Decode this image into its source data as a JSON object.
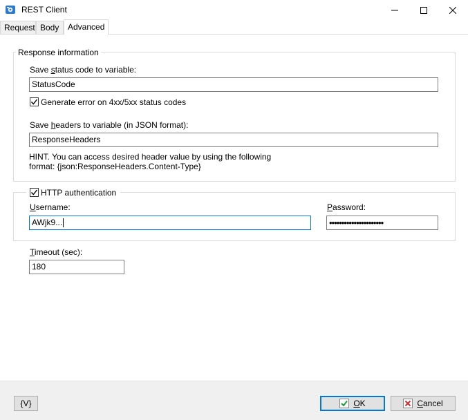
{
  "window": {
    "title": "REST Client",
    "icon": "rest-client-app-icon",
    "controls": {
      "minimize": "minimize-icon",
      "maximize": "maximize-icon",
      "close": "close-icon"
    }
  },
  "tabs": [
    {
      "label": "Request",
      "active": false
    },
    {
      "label": "Body",
      "active": false
    },
    {
      "label": "Advanced",
      "active": true
    }
  ],
  "response_info": {
    "legend": "Response information",
    "status_label_pre": "Save ",
    "status_label_accel": "s",
    "status_label_post": "tatus code to variable:",
    "status_value": "StatusCode",
    "generate_error_label": "Generate error on 4xx/5xx  status codes",
    "generate_error_checked": true,
    "headers_label_pre": "Save ",
    "headers_label_accel": "h",
    "headers_label_post": "eaders to variable (in JSON format):",
    "headers_value": "ResponseHeaders",
    "hint_line1": "HINT. You can access desired header value by using the following",
    "hint_line2": "format: {json:ResponseHeaders.Content-Type}"
  },
  "auth": {
    "label": "HTTP authentication",
    "checked": true,
    "username_accel": "U",
    "username_rest": "sername:",
    "username_value": "AWjk9...",
    "password_accel": "P",
    "password_rest": "assword:",
    "password_masked": "••••••••••••••••••••••"
  },
  "timeout": {
    "label_accel": "T",
    "label_rest": "imeout (sec):",
    "value": "180"
  },
  "footer": {
    "variables_label": "{V}",
    "ok_accel": "O",
    "ok_rest": "K",
    "cancel_accel": "C",
    "cancel_rest": "ancel"
  },
  "colors": {
    "focus_border": "#0078d7",
    "ok_icon": "#1e9e3a",
    "cancel_icon": "#d32f2f"
  }
}
